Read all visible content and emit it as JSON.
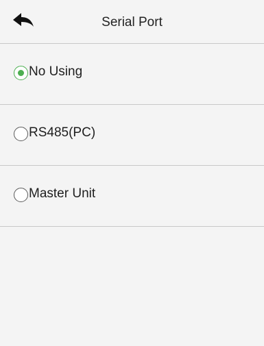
{
  "header": {
    "title": "Serial Port",
    "back_icon": "back-arrow-icon"
  },
  "options": [
    {
      "label": "No Using",
      "selected": true
    },
    {
      "label": "RS485(PC)",
      "selected": false
    },
    {
      "label": "Master Unit",
      "selected": false
    }
  ],
  "colors": {
    "accent": "#4caf50",
    "background": "#f4f4f4",
    "divider": "#c8c8c8"
  }
}
